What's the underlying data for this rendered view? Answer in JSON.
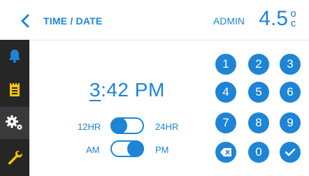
{
  "header": {
    "title": "TIME / DATE",
    "user": "ADMIN",
    "temperature": "4.5",
    "unit_top": "o",
    "unit_bottom": "c"
  },
  "sidebar": {
    "items": [
      {
        "icon": "bell-icon"
      },
      {
        "icon": "clipboard-icon"
      },
      {
        "icon": "gears-icon",
        "active": true
      },
      {
        "icon": "wrench-icon"
      }
    ]
  },
  "clock": {
    "hour_first": "3",
    "rest": ":42 PM"
  },
  "format_toggle": {
    "left": "12HR",
    "right": "24HR",
    "state": "12HR"
  },
  "ampm_toggle": {
    "left": "AM",
    "right": "PM",
    "state": "PM"
  },
  "keypad": {
    "keys": [
      "1",
      "2",
      "3",
      "4",
      "5",
      "6",
      "7",
      "8",
      "9",
      "0"
    ],
    "backspace_icon": "backspace-icon",
    "confirm_icon": "check-icon"
  },
  "colors": {
    "accent": "#1e84d6",
    "sidebar": "#262626",
    "icon": "#f5c400"
  }
}
